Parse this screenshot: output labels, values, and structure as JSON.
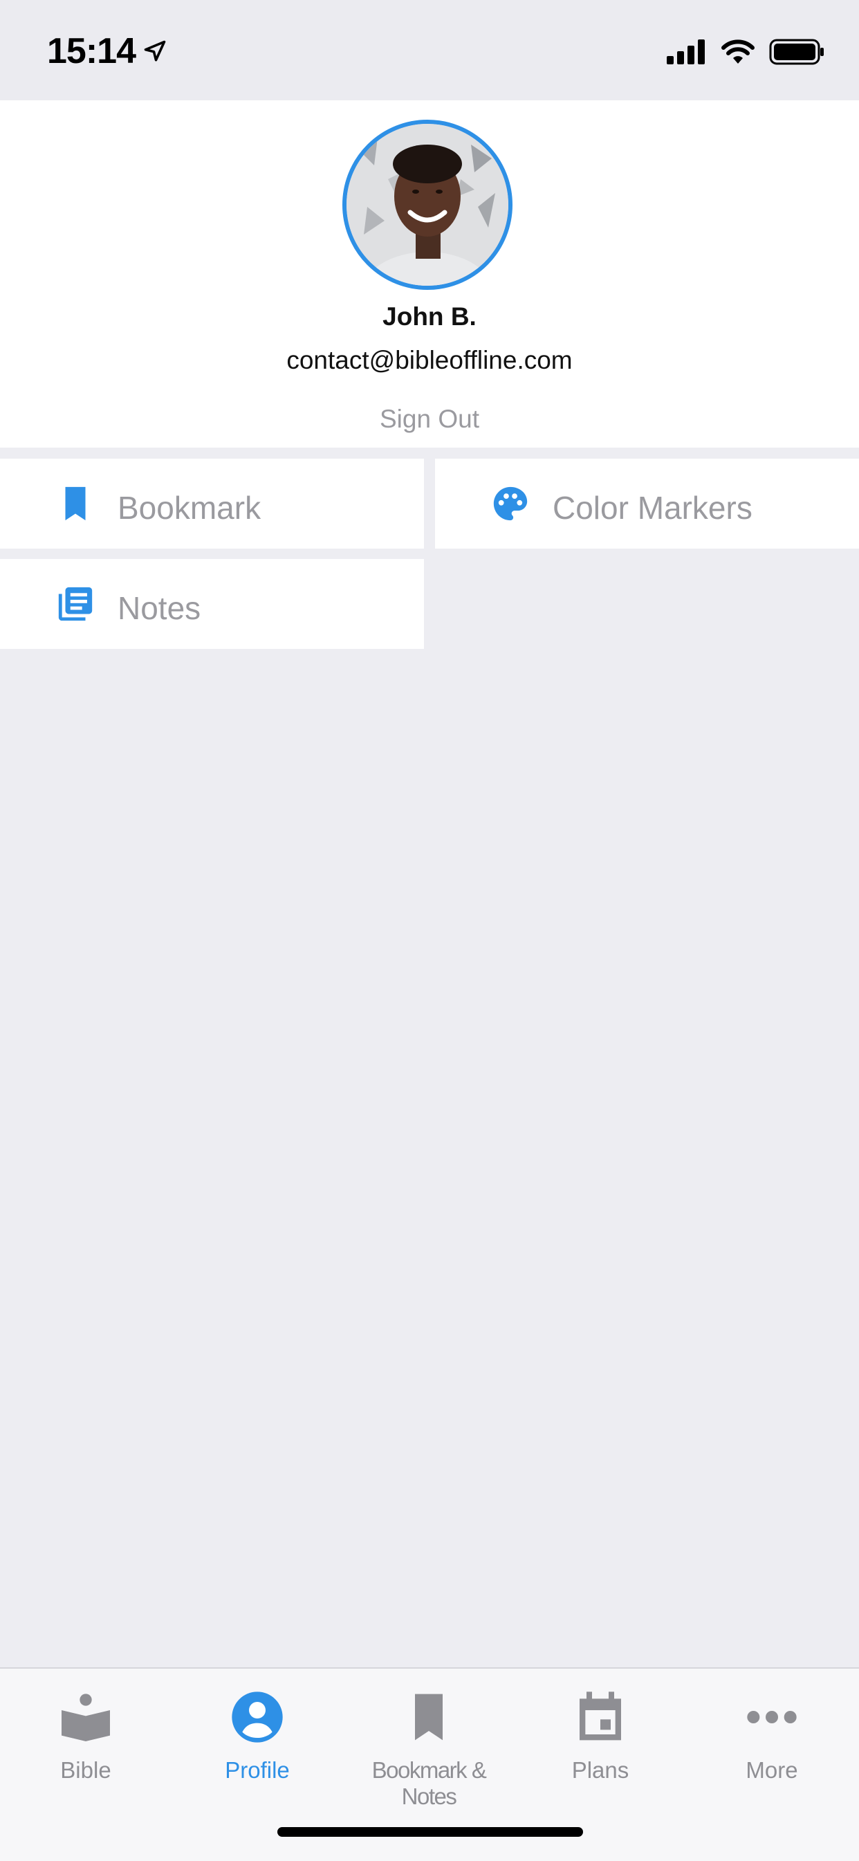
{
  "status": {
    "time": "15:14"
  },
  "profile": {
    "name": "John B.",
    "email": "contact@bibleoffline.com",
    "sign_out": "Sign Out"
  },
  "menu": {
    "bookmark": "Bookmark",
    "color_markers": "Color Markers",
    "notes": "Notes"
  },
  "tabs": [
    {
      "label": "Bible",
      "icon": "bible-icon",
      "active": false
    },
    {
      "label": "Profile",
      "icon": "profile-icon",
      "active": true
    },
    {
      "label": "Bookmark & Notes",
      "icon": "bookmark-icon",
      "active": false
    },
    {
      "label": "Plans",
      "icon": "calendar-icon",
      "active": false
    },
    {
      "label": "More",
      "icon": "more-icon",
      "active": false
    }
  ],
  "colors": {
    "accent": "#2E90E6",
    "inactive": "#8E8E93",
    "background": "#EDEDF2"
  }
}
